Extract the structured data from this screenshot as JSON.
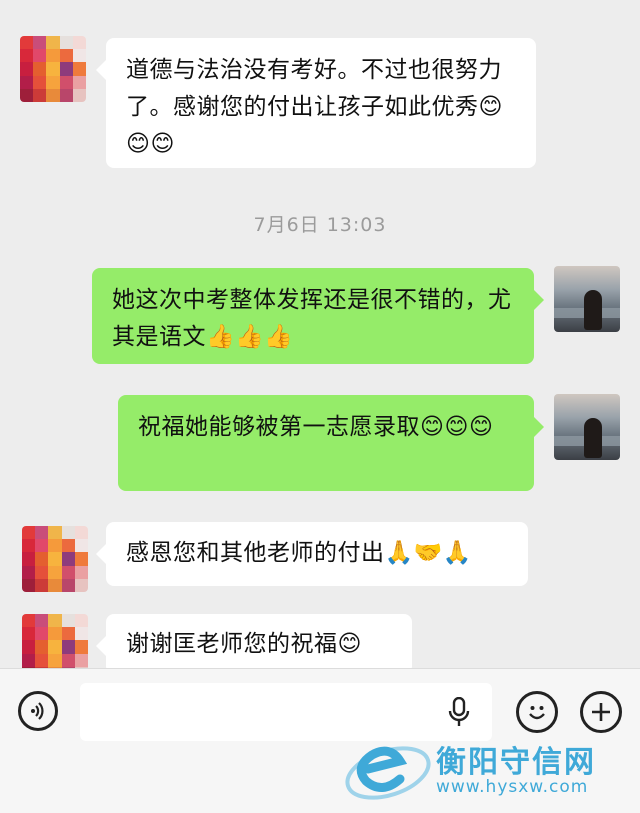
{
  "messages": [
    {
      "side": "left",
      "text": "道德与法治没有考好。不过也很努力了。感谢您的付出让孩子如此优秀😊😊😊"
    },
    {
      "side": "right",
      "text": "她这次中考整体发挥还是很不错的，尤其是语文👍👍👍"
    },
    {
      "side": "right",
      "text": "祝福她能够被第一志愿录取😊😊😊"
    },
    {
      "side": "left",
      "text": "感恩您和其他老师的付出🙏🤝🙏"
    },
    {
      "side": "left",
      "text": "谢谢匡老师您的祝福😊"
    }
  ],
  "timestamp": "7月6日 13:03",
  "input_bar": {
    "voice_icon": "voice-icon",
    "mic_icon": "microphone-icon",
    "emoji_icon": "emoji-icon",
    "plus_icon": "plus-icon"
  },
  "watermark": {
    "title": "衡阳守信网",
    "url": "www.hysxw.com",
    "logo_color": "#3fa9d8"
  },
  "colors": {
    "chat_bg": "#ededed",
    "self_bubble": "#95ec69",
    "other_bubble": "#ffffff"
  }
}
